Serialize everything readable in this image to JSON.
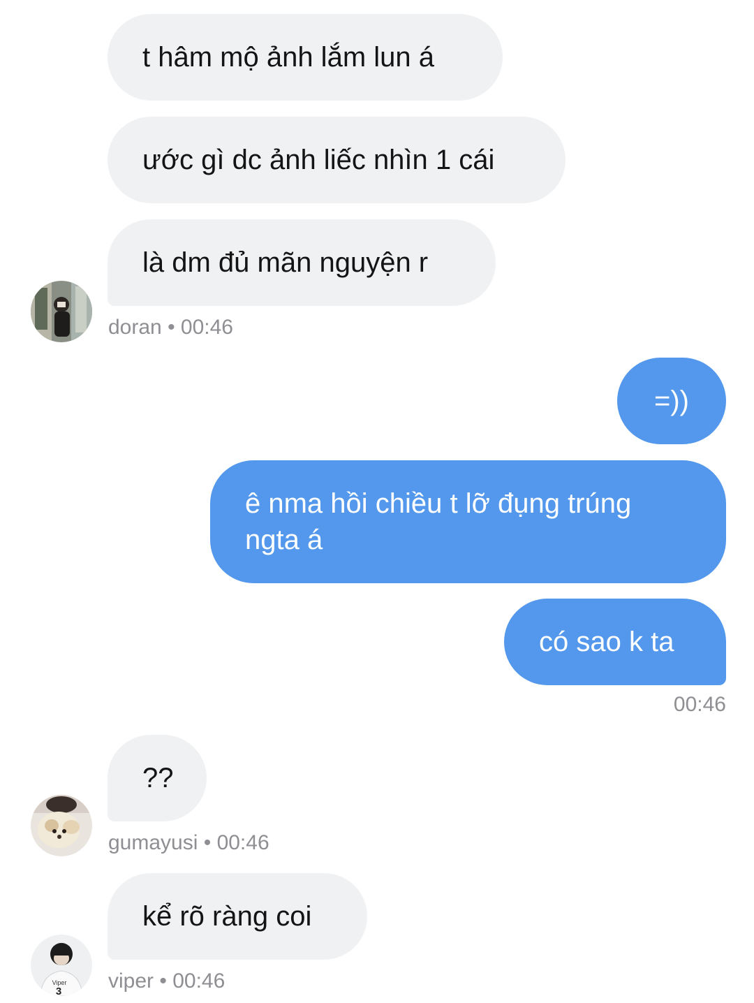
{
  "messages": [
    {
      "text": "t hâm mộ ảnh lắm lun á"
    },
    {
      "text": "ước gì dc ảnh liếc nhìn 1 cái"
    },
    {
      "text": "là dm đủ mãn nguyện r"
    },
    {
      "text": "=))"
    },
    {
      "text": "ê nma hồi chiều t lỡ đụng trúng",
      "text2": "ngta á"
    },
    {
      "text": "có sao k ta"
    },
    {
      "text": "??"
    },
    {
      "text": "kể rõ ràng coi"
    }
  ],
  "meta": {
    "doran": "doran • 00:46",
    "self_time": "00:46",
    "gumayusi": "gumayusi • 00:46",
    "viper": "viper • 00:46"
  },
  "avatars": {
    "viper_jersey_name": "Viper",
    "viper_jersey_number": "3"
  },
  "colors": {
    "incoming_bubble": "#f0f1f3",
    "outgoing_bubble": "#5398ec",
    "meta_text": "#8e8e93"
  }
}
